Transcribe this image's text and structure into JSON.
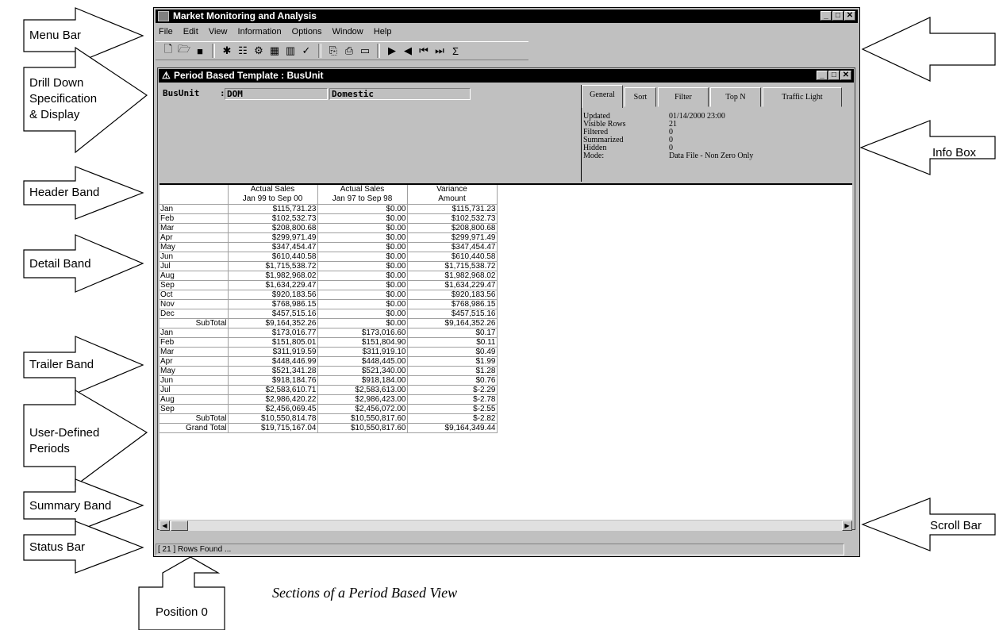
{
  "window": {
    "title": "Market Monitoring and Analysis",
    "menu": [
      "File",
      "Edit",
      "View",
      "Information",
      "Options",
      "Window",
      "Help"
    ]
  },
  "toolbar_icons": [
    "new-icon",
    "open-icon",
    "save-icon",
    "run-icon",
    "tree-icon",
    "drill-icon",
    "grid-icon",
    "chart-icon",
    "check-icon",
    "copy-icon",
    "print-icon",
    "export-icon",
    "play-icon",
    "back-icon",
    "first-icon",
    "last-icon",
    "sum-icon"
  ],
  "inner": {
    "title": "Period Based Template : BusUnit",
    "drill": {
      "field": "BusUnit",
      "sep": ":",
      "code": "DOM",
      "desc": "Domestic"
    }
  },
  "infobox": {
    "tabs": [
      "General",
      "Sort",
      "Filter",
      "Top N",
      "Traffic Light"
    ],
    "rows": [
      {
        "k": "Updated",
        "v": "01/14/2000 23:00"
      },
      {
        "k": "Visible Rows",
        "v": "21"
      },
      {
        "k": "Filtered",
        "v": "0"
      },
      {
        "k": "Summarized",
        "v": "0"
      },
      {
        "k": "Hidden",
        "v": "0"
      },
      {
        "k": "Mode:",
        "v": "Data File - Non Zero Only"
      }
    ]
  },
  "grid": {
    "headers": [
      [
        "",
        "Actual Sales",
        "Actual Sales",
        "Variance"
      ],
      [
        "",
        "Jan 99 to Sep 00",
        "Jan 97 to Sep 98",
        "Amount"
      ]
    ],
    "rows": [
      [
        "Jan",
        "$115,731.23",
        "$0.00",
        "$115,731.23"
      ],
      [
        "Feb",
        "$102,532.73",
        "$0.00",
        "$102,532.73"
      ],
      [
        "Mar",
        "$208,800.68",
        "$0.00",
        "$208,800.68"
      ],
      [
        "Apr",
        "$299,971.49",
        "$0.00",
        "$299,971.49"
      ],
      [
        "May",
        "$347,454.47",
        "$0.00",
        "$347,454.47"
      ],
      [
        "Jun",
        "$610,440.58",
        "$0.00",
        "$610,440.58"
      ],
      [
        "Jul",
        "$1,715,538.72",
        "$0.00",
        "$1,715,538.72"
      ],
      [
        "Aug",
        "$1,982,968.02",
        "$0.00",
        "$1,982,968.02"
      ],
      [
        "Sep",
        "$1,634,229.47",
        "$0.00",
        "$1,634,229.47"
      ],
      [
        "Oct",
        "$920,183.56",
        "$0.00",
        "$920,183.56"
      ],
      [
        "Nov",
        "$768,986.15",
        "$0.00",
        "$768,986.15"
      ],
      [
        "Dec",
        "$457,515.16",
        "$0.00",
        "$457,515.16"
      ],
      [
        "SubTotal",
        "$9,164,352.26",
        "$0.00",
        "$9,164,352.26"
      ],
      [
        "Jan",
        "$173,016.77",
        "$173,016.60",
        "$0.17"
      ],
      [
        "Feb",
        "$151,805.01",
        "$151,804.90",
        "$0.11"
      ],
      [
        "Mar",
        "$311,919.59",
        "$311,919.10",
        "$0.49"
      ],
      [
        "Apr",
        "$448,446.99",
        "$448,445.00",
        "$1.99"
      ],
      [
        "May",
        "$521,341.28",
        "$521,340.00",
        "$1.28"
      ],
      [
        "Jun",
        "$918,184.76",
        "$918,184.00",
        "$0.76"
      ],
      [
        "Jul",
        "$2,583,610.71",
        "$2,583,613.00",
        "$-2.29"
      ],
      [
        "Aug",
        "$2,986,420.22",
        "$2,986,423.00",
        "$-2.78"
      ],
      [
        "Sep",
        "$2,456,069.45",
        "$2,456,072.00",
        "$-2.55"
      ],
      [
        "SubTotal",
        "$10,550,814.78",
        "$10,550,817.60",
        "$-2.82"
      ],
      [
        "Grand Total",
        "$19,715,167.04",
        "$10,550,817.60",
        "$9,164,349.44"
      ]
    ]
  },
  "status": "[ 21 ] Rows Found ...",
  "callouts": {
    "menu_bar": "Menu Bar",
    "drill_down_1": "Drill Down",
    "drill_down_2": "Specification",
    "drill_down_3": "& Display",
    "header_band": "Header Band",
    "detail_band": "Detail Band",
    "trailer_band": "Trailer Band",
    "user_defined_1": "User-Defined",
    "user_defined_2": "Periods",
    "summary_band": "Summary Band",
    "status_bar": "Status Bar",
    "info_box": "Info Box",
    "scroll_bar": "Scroll Bar",
    "position_0": "Position 0"
  },
  "caption": "Sections of a Period Based View"
}
